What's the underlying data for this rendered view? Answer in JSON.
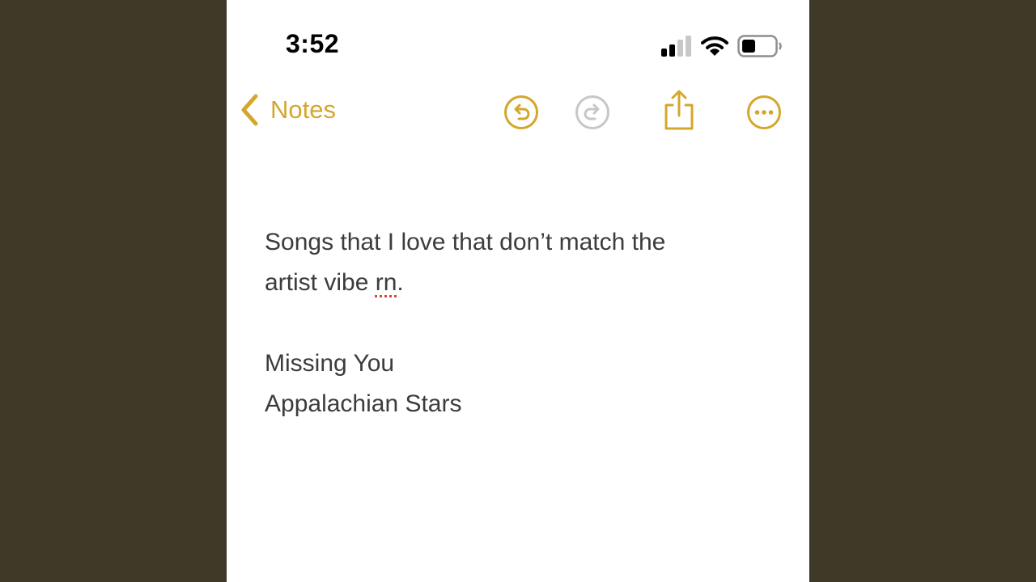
{
  "status_bar": {
    "time": "3:52",
    "signal_icon": "cellular-signal-2-of-4-icon",
    "wifi_icon": "wifi-icon",
    "battery_icon": "battery-icon",
    "battery_level": 0.4
  },
  "nav": {
    "back_label": "Notes",
    "back_icon": "chevron-left-icon",
    "undo_icon": "undo-icon",
    "redo_icon": "redo-icon",
    "share_icon": "share-icon",
    "more_icon": "more-icon",
    "accent_color": "#d4a72c",
    "disabled_color": "#c7c7c7"
  },
  "note": {
    "line1": "Songs that I love that don’t match the",
    "line2_prefix": "artist vibe ",
    "line2_misspelled": "rn",
    "line2_suffix": ".",
    "line3": "",
    "line4": "Missing You",
    "line5": "Appalachian Stars"
  }
}
